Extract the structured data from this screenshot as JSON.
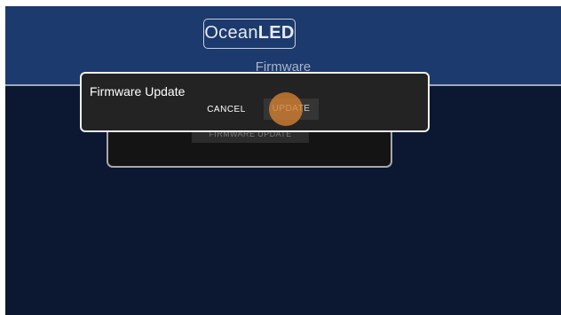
{
  "app": {
    "logo_text": "Ocean",
    "logo_text_bold": "LED",
    "section_title": "Firmware"
  },
  "panel": {
    "button_label": "FIRMWARE UPDATE"
  },
  "dialog": {
    "title": "Firmware Update",
    "cancel_label": "CANCEL",
    "update_label": "UPDATE"
  },
  "colors": {
    "header_background": "#1c3a6d",
    "page_background": "#0c1831",
    "dialog_background": "#232323",
    "touch_indicator": "#d68232"
  }
}
